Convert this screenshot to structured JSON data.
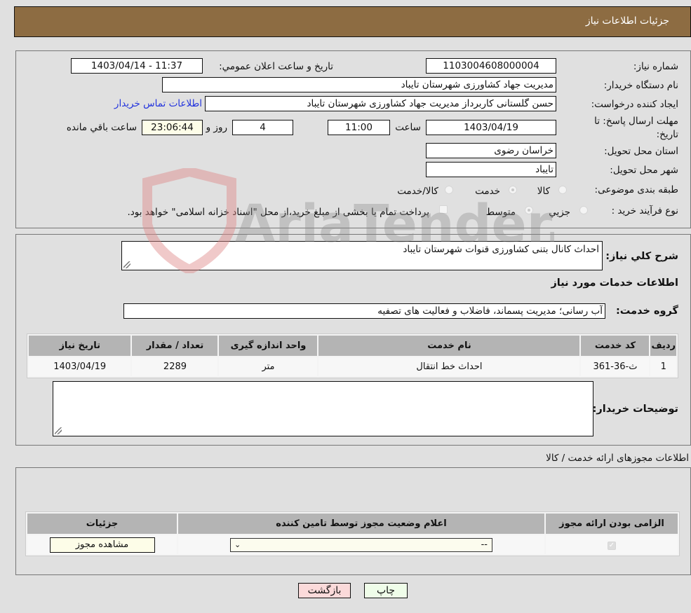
{
  "header": {
    "title": "جزئیات اطلاعات نیاز"
  },
  "form": {
    "need_number_label": "شماره نیاز:",
    "need_number": "1103004608000004",
    "announce_label": "تاریخ و ساعت اعلان عمومي:",
    "announce_value": "1403/04/14 - 11:37",
    "buyer_org_label": "نام دستگاه خریدار:",
    "buyer_org": "مدیریت جهاد کشاورزی شهرستان تایباد",
    "creator_label": "ایجاد کننده درخواست:",
    "creator": "حسن گلستانی کاربرداز مدیریت جهاد کشاورزی شهرستان تایباد",
    "contact_link": "اطلاعات تماس خریدار",
    "deadline_label": "مهلت ارسال پاسخ: تا تاریخ:",
    "deadline_date": "1403/04/19",
    "time_label": "ساعت",
    "deadline_time": "11:00",
    "days_value": "4",
    "days_label": "روز و",
    "remaining_time": "23:06:44",
    "remaining_label": "ساعت باقي مانده",
    "province_label": "استان محل تحویل:",
    "province": "خراسان رضوی",
    "city_label": "شهر محل تحویل:",
    "city": "تایباد",
    "category_label": "طبقه بندی موضوعی:",
    "category_options": [
      {
        "label": "کالا",
        "selected": false
      },
      {
        "label": "خدمت",
        "selected": true
      },
      {
        "label": "کالا/خدمت",
        "selected": false
      }
    ],
    "process_label": "نوع فرآیند خرید :",
    "process_options": [
      {
        "label": "جزيي",
        "selected": false
      },
      {
        "label": "متوسط",
        "selected": true
      }
    ],
    "treasury_note": "پرداخت تمام یا بخشی از مبلغ خرید،از محل \"اسناد خزانه اسلامی\" خواهد بود.",
    "treasury_checked": false
  },
  "description": {
    "label": "شرح کلي نیاز:",
    "value": "احداث کانال بتنی کشاورزی قنوات شهرستان تایباد",
    "services_heading": "اطلاعات خدمات مورد نیاز",
    "service_group_label": "گروه خدمت:",
    "service_group": "آب رسانی؛ مدیریت پسماند، فاضلاب و فعالیت های تصفیه"
  },
  "services_table": {
    "columns": [
      "ردیف",
      "کد خدمت",
      "نام خدمت",
      "واحد اندازه گیری",
      "تعداد / مقدار",
      "تاریخ نیاز"
    ],
    "rows": [
      [
        "1",
        "ث-36-361",
        "احداث خط انتقال",
        "متر",
        "2289",
        "1403/04/19"
      ]
    ]
  },
  "buyer_notes": {
    "label": "توضیحات خریدار:",
    "value": ""
  },
  "permits": {
    "heading": "اطلاعات مجوزهای ارائه خدمت / کالا",
    "columns": [
      "الزامی بودن ارائه مجوز",
      "اعلام وضعیت مجوز توسط تامین کننده",
      "جزئیات"
    ],
    "rows": [
      {
        "required": true,
        "status": "--",
        "details_button": "مشاهده مجوز"
      }
    ]
  },
  "buttons": {
    "print": "چاپ",
    "back": "بازگشت"
  },
  "watermark": "AriaTender.neT"
}
